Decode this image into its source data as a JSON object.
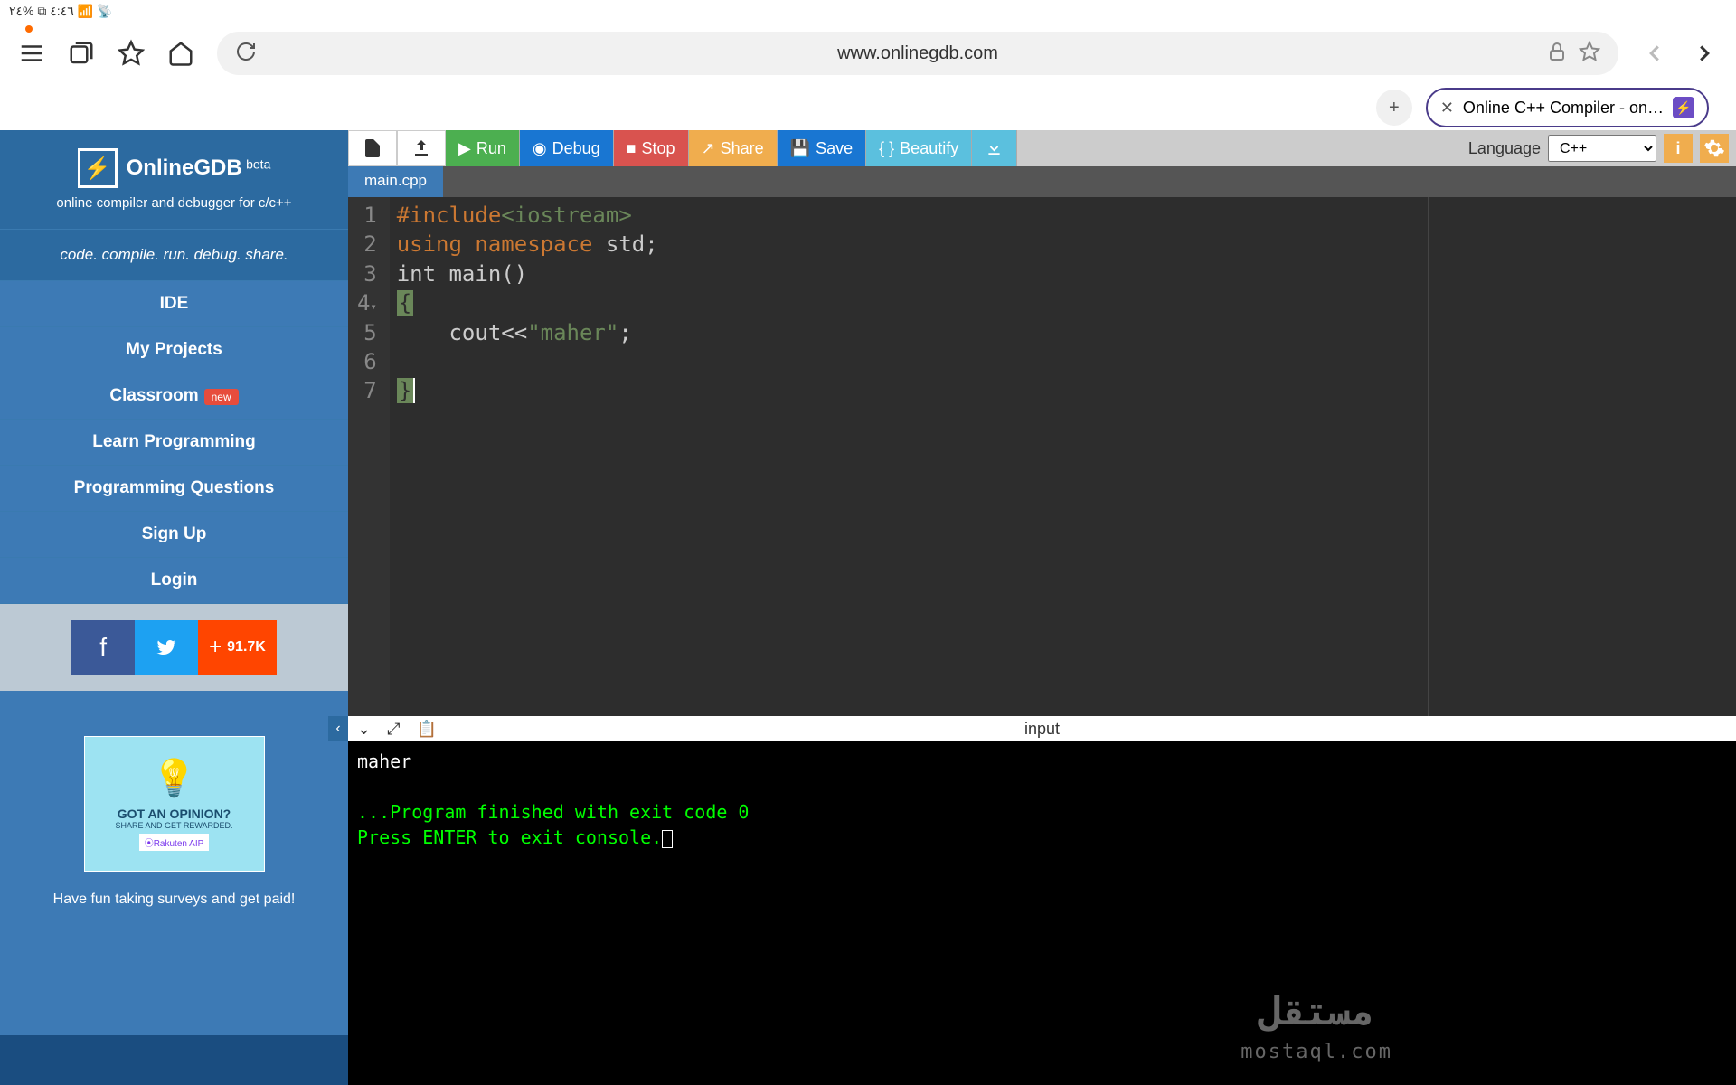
{
  "status_bar": "٤:٤٦ ⧉ %٢٤ 📶 📡",
  "browser": {
    "url": "www.onlinegdb.com",
    "tab_title": "Online C++ Compiler - on…"
  },
  "sidebar": {
    "logo": "⚡",
    "brand": "OnlineGDB",
    "beta": "beta",
    "tagline": "online compiler and debugger for c/c++",
    "motto": "code. compile. run. debug. share.",
    "nav": [
      "IDE",
      "My Projects",
      "Classroom",
      "Learn Programming",
      "Programming Questions",
      "Sign Up",
      "Login"
    ],
    "new_badge": "new",
    "share_count": "91.7K",
    "ad_title": "GOT AN OPINION?",
    "ad_sub": "SHARE AND GET REWARDED.",
    "ad_brand": "⦿Rakuten AIP",
    "ad_caption": "Have fun taking surveys and get paid!"
  },
  "toolbar": {
    "run": "Run",
    "debug": "Debug",
    "stop": "Stop",
    "share": "Share",
    "save": "Save",
    "beautify": "Beautify",
    "lang_label": "Language",
    "lang_value": "C++"
  },
  "file_tab": "main.cpp",
  "code": {
    "lines": [
      "1",
      "2",
      "3",
      "4",
      "5",
      "6",
      "7"
    ],
    "l1_a": "#include",
    "l1_b": "<iostream>",
    "l2_a": "using",
    "l2_b": "namespace",
    "l2_c": " std;",
    "l3": "int main()",
    "l4": "{",
    "l5_a": "    cout<<",
    "l5_b": "\"maher\"",
    "l5_c": ";",
    "l7": "}"
  },
  "console": {
    "title": "input",
    "out1": "maher",
    "out2": "...Program finished with exit code 0",
    "out3": "Press ENTER to exit console."
  },
  "watermark": {
    "arabic": "مستقل",
    "latin": "mostaql.com"
  }
}
